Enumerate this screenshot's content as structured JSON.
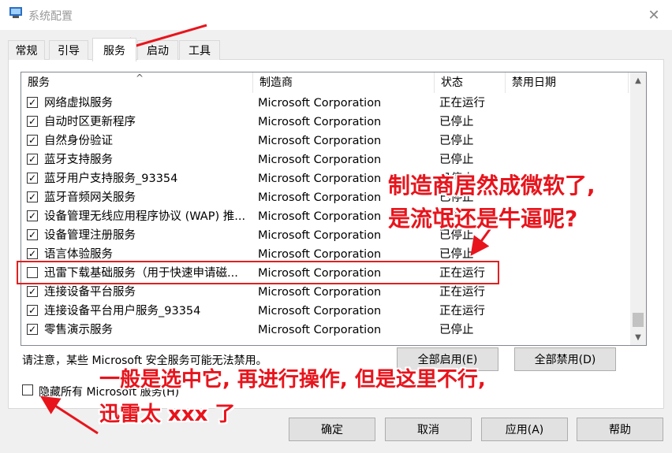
{
  "window": {
    "title": "系统配置",
    "close_glyph": "✕"
  },
  "tabs": [
    {
      "label": "常规"
    },
    {
      "label": "引导"
    },
    {
      "label": "服务",
      "active": true
    },
    {
      "label": "启动"
    },
    {
      "label": "工具"
    }
  ],
  "columns": {
    "service": "服务",
    "manufacturer": "制造商",
    "status": "状态",
    "disabled_date": "禁用日期"
  },
  "rows": [
    {
      "checked": true,
      "name": "网络虚拟服务",
      "manufacturer": "Microsoft Corporation",
      "status": "正在运行"
    },
    {
      "checked": true,
      "name": "自动时区更新程序",
      "manufacturer": "Microsoft Corporation",
      "status": "已停止"
    },
    {
      "checked": true,
      "name": "自然身份验证",
      "manufacturer": "Microsoft Corporation",
      "status": "已停止"
    },
    {
      "checked": true,
      "name": "蓝牙支持服务",
      "manufacturer": "Microsoft Corporation",
      "status": "已停止"
    },
    {
      "checked": true,
      "name": "蓝牙用户支持服务_93354",
      "manufacturer": "Microsoft Corporation",
      "status": "已停止"
    },
    {
      "checked": true,
      "name": "蓝牙音频网关服务",
      "manufacturer": "Microsoft Corporation",
      "status": "已停止"
    },
    {
      "checked": true,
      "name": "设备管理无线应用程序协议 (WAP) 推...",
      "manufacturer": "Microsoft Corporation",
      "status": "已停止"
    },
    {
      "checked": true,
      "name": "设备管理注册服务",
      "manufacturer": "Microsoft Corporation",
      "status": "已停止"
    },
    {
      "checked": true,
      "name": "语言体验服务",
      "manufacturer": "Microsoft Corporation",
      "status": "已停止"
    },
    {
      "checked": false,
      "name": "迅雷下载基础服务（用于快速申请磁...",
      "manufacturer": "Microsoft Corporation",
      "status": "正在运行"
    },
    {
      "checked": true,
      "name": "连接设备平台服务",
      "manufacturer": "Microsoft Corporation",
      "status": "正在运行"
    },
    {
      "checked": true,
      "name": "连接设备平台用户服务_93354",
      "manufacturer": "Microsoft Corporation",
      "status": "正在运行"
    },
    {
      "checked": true,
      "name": "零售演示服务",
      "manufacturer": "Microsoft Corporation",
      "status": "已停止"
    }
  ],
  "note": "请注意，某些 Microsoft 安全服务可能无法禁用。",
  "buttons": {
    "enable_all": "全部启用(E)",
    "disable_all": "全部禁用(D)",
    "ok": "确定",
    "cancel": "取消",
    "apply": "应用(A)",
    "help": "帮助"
  },
  "hide_ms": {
    "label": "隐藏所有 Microsoft 服务(H)",
    "checked": false
  },
  "annotations": {
    "line1": "制造商居然成微软了,",
    "line2": "是流氓还是牛逼呢?",
    "line3": "一般是选中它, 再进行操作, 但是这里不行,",
    "line4": "迅雷太 xxx 了"
  },
  "colors": {
    "annotation": "#e8141c",
    "highlight": "#e02020"
  },
  "check_glyph": "✓"
}
